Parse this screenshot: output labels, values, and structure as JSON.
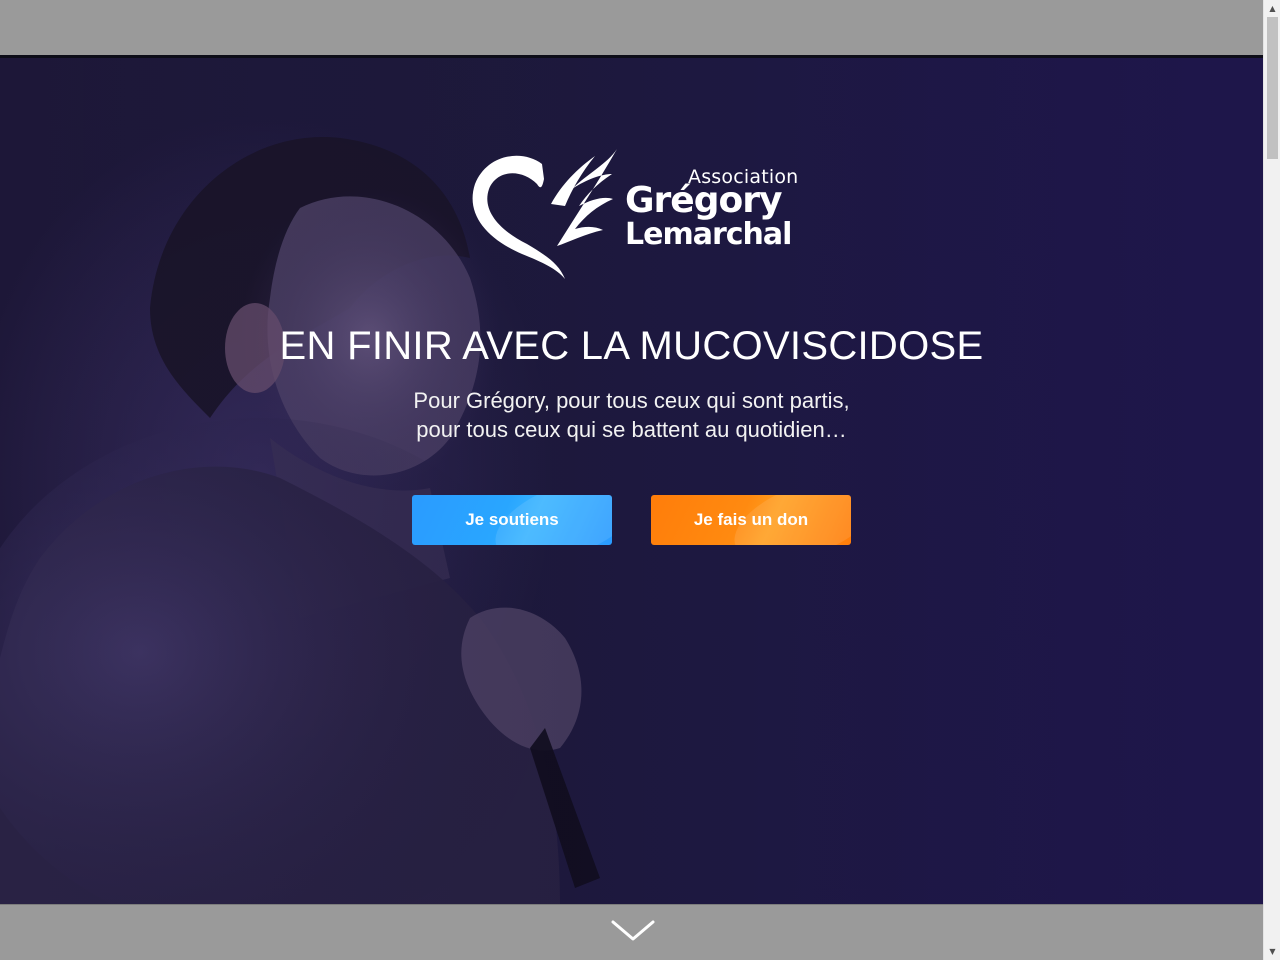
{
  "logo": {
    "association": "Association",
    "first_name": "Grégory",
    "last_name": "Lemarchal"
  },
  "hero": {
    "headline": "EN FINIR AVEC LA MUCOVISCIDOSE",
    "subline_1": "Pour Grégory, pour tous ceux qui sont partis,",
    "subline_2": "pour tous ceux qui se battent au quotidien…"
  },
  "buttons": {
    "support": "Je soutiens",
    "donate": "Je fais un don"
  },
  "colors": {
    "support_button": "#2a9bff",
    "donate_button": "#ff7d0a",
    "hero_background": "#1e1a3d",
    "frame_gray": "#9a9a9a"
  },
  "icons": {
    "scroll_down": "chevron-down-icon",
    "scrollbar_up": "triangle-up-icon",
    "scrollbar_down": "triangle-down-icon"
  }
}
